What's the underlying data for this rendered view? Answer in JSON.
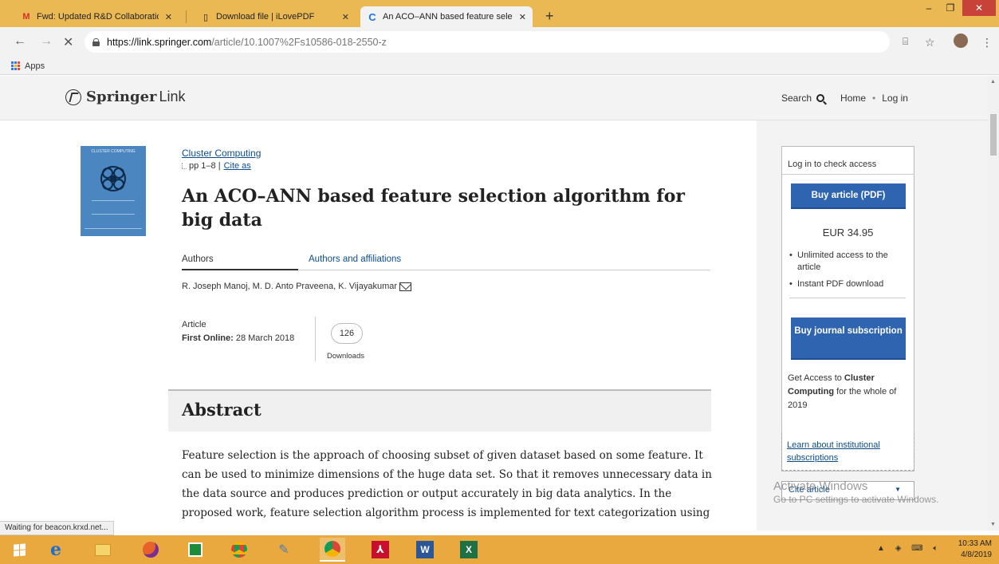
{
  "browser": {
    "tabs": [
      {
        "label": "Fwd: Updated R&D Collaboration",
        "icon": "gmail-icon"
      },
      {
        "label": "Download file | iLovePDF",
        "icon": "file-icon"
      },
      {
        "label": "An ACO–ANN based feature sele",
        "icon": "loading-icon"
      }
    ],
    "new_tab": "+",
    "url_host": "https://link.springer.com",
    "url_path": "/article/10.1007%2Fs10586-018-2550-z",
    "bookmarks_apps": "Apps",
    "status_text": "Waiting for beacon.krxd.net..."
  },
  "header": {
    "logo_bold": "Springer",
    "logo_light": "Link",
    "search_label": "Search",
    "home_label": "Home",
    "login_label": "Log in",
    "nav_sep": "•"
  },
  "cover": {
    "title": "CLUSTER COMPUTING"
  },
  "article": {
    "journal": "Cluster Computing",
    "pages": "pp 1–8 |",
    "cite_as": "Cite as",
    "title": "An ACO–ANN based feature selection algorithm for big data",
    "tab_authors": "Authors",
    "tab_affiliations": "Authors and affiliations",
    "authors": "R. Joseph Manoj, M. D. Anto Praveena, K. Vijayakumar",
    "type": "Article",
    "first_online_label": "First Online:",
    "first_online_date": "28 March 2018",
    "downloads_count": "126",
    "downloads_label": "Downloads",
    "abstract_heading": "Abstract",
    "abstract_text": "Feature selection is the approach of choosing subset of given dataset based on some feature. It can be used to minimize dimensions of the huge data set. So that it removes unnecessary data in the data source and produces prediction or output accurately in big data analytics. In the proposed work, feature selection algorithm process is implemented for text categorization using"
  },
  "sidebar": {
    "access_heading": "Log in to check access",
    "buy_article": "Buy article (PDF)",
    "price": "EUR 34.95",
    "bullets": [
      "Unlimited access to the article",
      "Instant PDF download"
    ],
    "buy_journal": "Buy journal subscription",
    "get_access_pre": "Get Access to ",
    "get_access_journal": "Cluster Computing",
    "get_access_post": " for the whole of 2019",
    "institution_link": "Learn about institutional subscriptions",
    "cite_article": "Cite article"
  },
  "watermark": {
    "line1": "Activate Windows",
    "line2": "Go to PC settings to activate Windows."
  },
  "taskbar": {
    "time": "10:33 AM",
    "date": "4/8/2019"
  },
  "colors": {
    "tabstrip": "#eab954",
    "taskbar": "#e9a93f",
    "springer_blue": "#2f64b0",
    "link_blue": "#0d4d8c"
  }
}
